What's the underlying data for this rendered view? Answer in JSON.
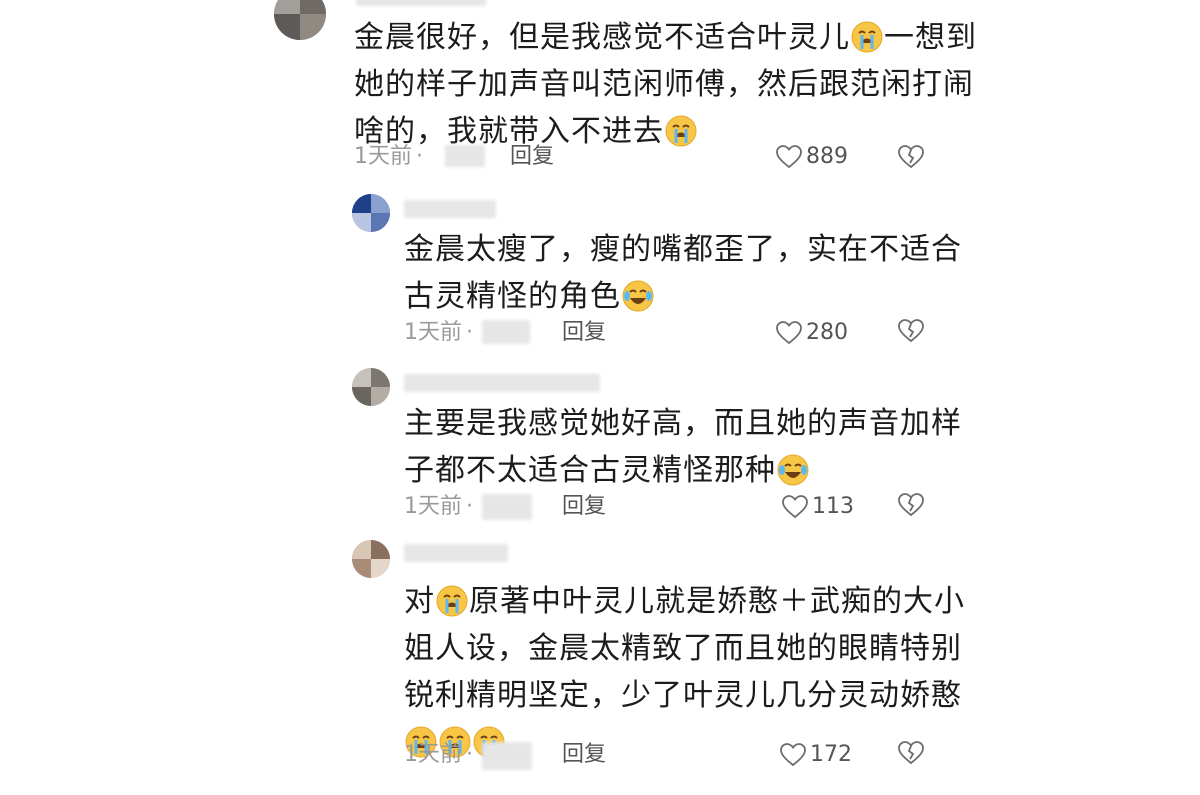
{
  "comments": [
    {
      "lines": [
        "金晨很好，但是我感觉不适合叶灵儿",
        "一想到",
        "她的样子加声音叫范闲师傅，然后跟范闲打闹",
        "啥的，我就带入不进去"
      ],
      "time": "1天前",
      "dot": "·",
      "reply": "回复",
      "likes": "889"
    },
    {
      "lines": [
        "金晨太瘦了，瘦的嘴都歪了，实在不适合",
        "古灵精怪的角色"
      ],
      "time": "1天前",
      "dot": "·",
      "reply": "回复",
      "likes": "280"
    },
    {
      "lines": [
        "主要是我感觉她好高，而且她的声音加样",
        "子都不太适合古灵精怪那种"
      ],
      "time": "1天前",
      "dot": "·",
      "reply": "回复",
      "likes": "113"
    },
    {
      "lines": [
        "对",
        "原著中叶灵儿就是娇憨＋武痴的大小",
        "姐人设，金晨太精致了而且她的眼睛特别",
        "锐利精明坚定，少了叶灵儿几分灵动娇憨"
      ],
      "time": "1天前",
      "dot": "·",
      "reply": "回复",
      "likes": "172"
    }
  ],
  "icons": {
    "crying_emoji": "loudly-crying-face",
    "laughing_emoji": "tears-of-joy-face",
    "like": "heart-outline",
    "dislike": "broken-heart-outline"
  },
  "colors": {
    "meta": "#9a9a9a",
    "text": "#1c1c1c",
    "emoji": "#f7c948"
  }
}
